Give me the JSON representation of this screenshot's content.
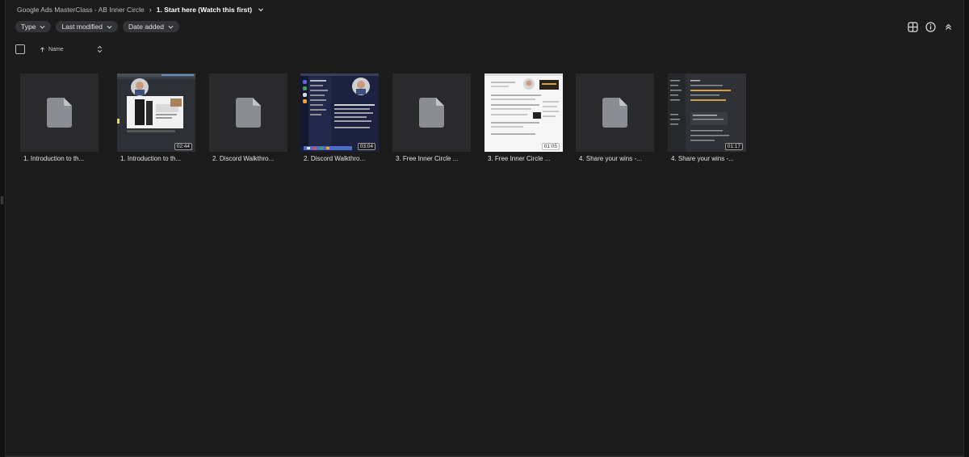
{
  "breadcrumb": {
    "parent": "Google Ads MasterClass - AB Inner Circle",
    "separator": "›",
    "current": "1. Start here (Watch this first)"
  },
  "filters": [
    {
      "label": "Type"
    },
    {
      "label": "Last modified"
    },
    {
      "label": "Date added"
    }
  ],
  "list_header": {
    "name_label": "Name",
    "sort_direction": "ascending"
  },
  "toolbar": {
    "icons": [
      "grid-view-icon",
      "info-icon",
      "collapse-icon"
    ]
  },
  "files": [
    {
      "name": "1. Introduction to th...",
      "kind": "placeholder",
      "duration": ""
    },
    {
      "name": "1. Introduction to th...",
      "kind": "video-course",
      "duration": "02:44"
    },
    {
      "name": "2. Discord Walkthro...",
      "kind": "placeholder",
      "duration": ""
    },
    {
      "name": "2. Discord Walkthro...",
      "kind": "video-discord",
      "duration": "03:04"
    },
    {
      "name": "3. Free Inner Circle ...",
      "kind": "placeholder",
      "duration": ""
    },
    {
      "name": "3. Free Inner Circle ...",
      "kind": "video-white",
      "duration": "01:05"
    },
    {
      "name": "4. Share your wins -...",
      "kind": "placeholder",
      "duration": ""
    },
    {
      "name": "4. Share your wins -...",
      "kind": "video-dark",
      "duration": "01:17"
    }
  ],
  "colors": {
    "background": "#1b1b1b",
    "chip": "#333437",
    "tile": "#2a2a2c",
    "file_icon": "#8a8d94"
  }
}
